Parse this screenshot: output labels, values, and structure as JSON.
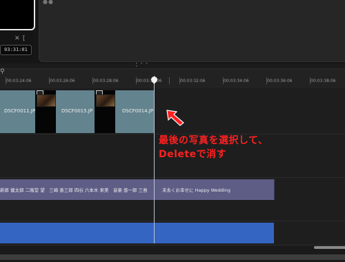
{
  "preview": {
    "timecode": "03:31:01",
    "controls": [
      "[",
      "✕",
      "⧉"
    ]
  },
  "ruler": {
    "ticks": [
      "00:03:24:06",
      "00:03:26:06",
      "00:03:28:06",
      "00:03:30:06",
      "00:03:32:06",
      "00:03:34:06",
      "00:03:36:06",
      "00:03:38:06"
    ]
  },
  "video_track": {
    "clips": [
      {
        "label": "DSCF0011.JP"
      },
      {
        "label": "DSCF0015.JP"
      },
      {
        "label": "DSCF0014.JP"
      }
    ]
  },
  "title_track": {
    "clip_text_1": "新郎 健太郎 二階堂 望　三崎 善三郎 四谷 六本木 来美　音楽 悠一郎 三島",
    "clip_text_2": "末永くお幸せに Happy Wedding"
  },
  "annotation": {
    "line1": "最後の写真を選択して、",
    "line2": "Deleteで消す",
    "color": "#ff2020"
  },
  "colors": {
    "photo_clip": "#63838e",
    "title_clip": "#5e5d86",
    "music_clip": "#3565c2"
  }
}
